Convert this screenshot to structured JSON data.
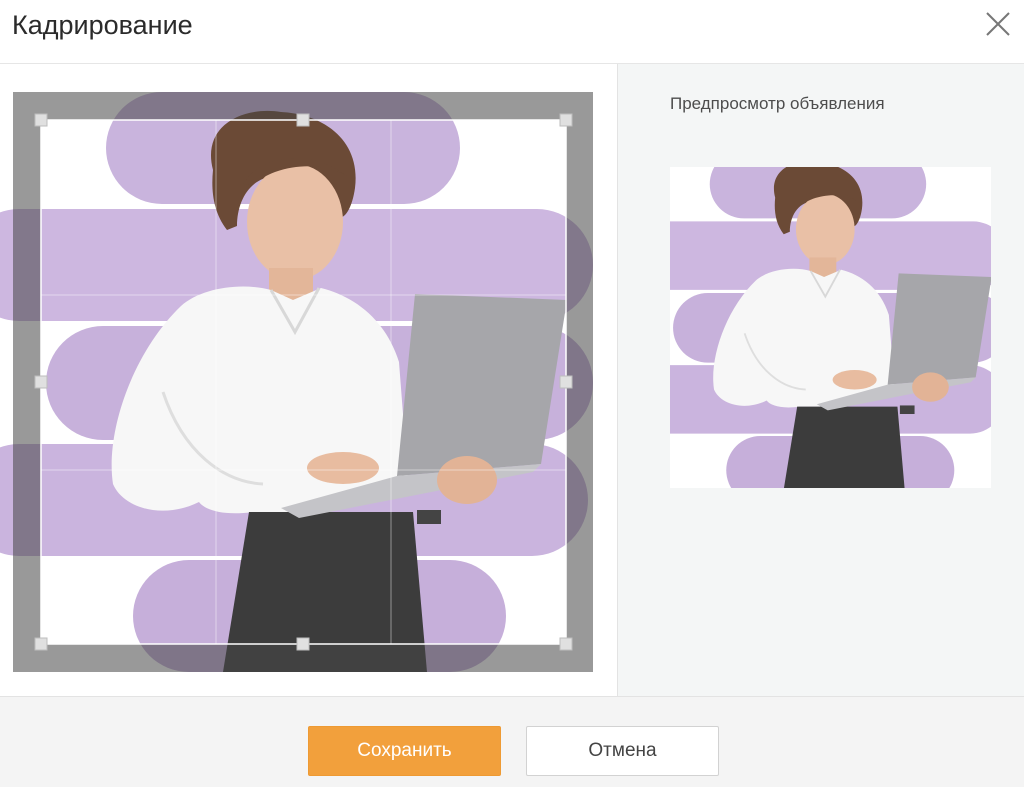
{
  "dialog": {
    "title": "Кадрирование",
    "close_icon": "close-icon"
  },
  "preview": {
    "label": "Предпросмотр объявления"
  },
  "footer": {
    "save_label": "Сохранить",
    "cancel_label": "Отмена"
  },
  "colors": {
    "accent": "#f2a03c",
    "lavender": "#c8b2dc"
  }
}
